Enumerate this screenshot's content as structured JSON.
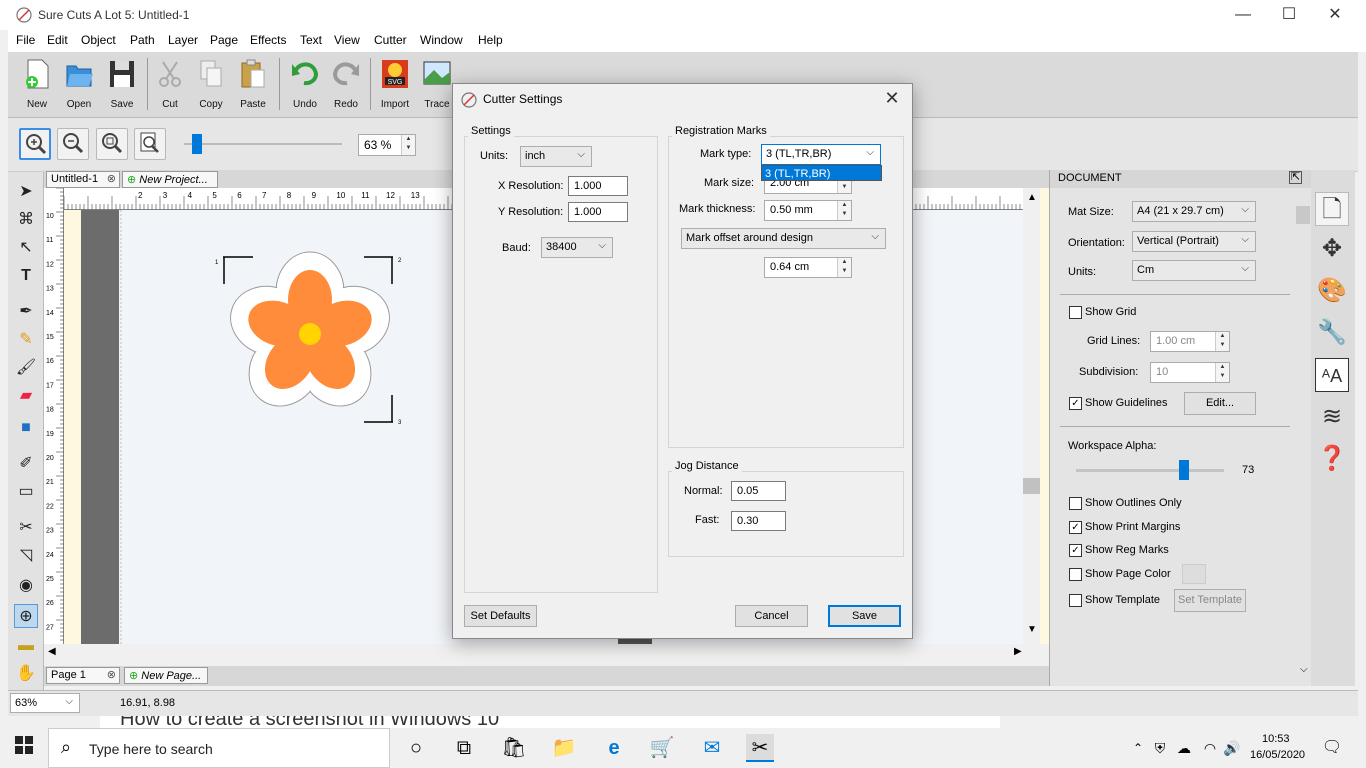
{
  "window": {
    "title": "Sure Cuts A Lot 5: Untitled-1",
    "minimize": "—",
    "maximize": "☐",
    "close": "✕"
  },
  "menu": [
    "File",
    "Edit",
    "Object",
    "Path",
    "Layer",
    "Page",
    "Effects",
    "Text",
    "View",
    "Cutter",
    "Window",
    "Help"
  ],
  "toolbar": {
    "new": "New",
    "open": "Open",
    "save": "Save",
    "cut": "Cut",
    "copy": "Copy",
    "paste": "Paste",
    "undo": "Undo",
    "redo": "Redo",
    "import": "Import",
    "trace": "Trace"
  },
  "zoom": {
    "value": "63 %"
  },
  "tabs": {
    "doc": "Untitled-1",
    "new_project": "New Project...",
    "page": "Page 1",
    "new_page": "New Page..."
  },
  "status": {
    "zoom": "63%",
    "coords": "16.91, 8.98"
  },
  "ruler_left_labels": [
    "10",
    "11",
    "12",
    "13",
    "14",
    "15",
    "16",
    "17",
    "18",
    "19",
    "20",
    "21",
    "22",
    "23",
    "24",
    "25",
    "26",
    "27"
  ],
  "ruler_top_labels": [
    "2",
    "3",
    "4",
    "5",
    "6",
    "7",
    "8",
    "9",
    "10",
    "11",
    "12",
    "13"
  ],
  "reg_mark_labels": [
    "1",
    "2",
    "3"
  ],
  "document_panel": {
    "header": "DOCUMENT",
    "mat_size_label": "Mat Size:",
    "mat_size": "A4 (21 x 29.7 cm)",
    "orientation_label": "Orientation:",
    "orientation": "Vertical (Portrait)",
    "units_label": "Units:",
    "units": "Cm",
    "show_grid": "Show Grid",
    "grid_lines_label": "Grid Lines:",
    "grid_lines": "1.00 cm",
    "subdivision_label": "Subdivision:",
    "subdivision": "10",
    "show_guidelines": "Show Guidelines",
    "edit_button": "Edit...",
    "workspace_alpha_label": "Workspace Alpha:",
    "workspace_alpha": "73",
    "workspace_alpha_level": 0.73,
    "show_outlines_only": "Show Outlines Only",
    "show_print_margins": "Show Print Margins",
    "show_reg_marks": "Show Reg Marks",
    "show_page_color": "Show Page Color",
    "show_template": "Show Template",
    "set_template": "Set Template"
  },
  "dialog": {
    "title": "Cutter Settings",
    "settings_group": "Settings",
    "units_label": "Units:",
    "units": "inch",
    "x_res_label": "X Resolution:",
    "x_res": "1.000",
    "y_res_label": "Y Resolution:",
    "y_res": "1.000",
    "baud_label": "Baud:",
    "baud": "38400",
    "reg_group": "Registration Marks",
    "mark_type_label": "Mark type:",
    "mark_type": "3 (TL,TR,BR)",
    "mark_type_option": "3 (TL,TR,BR)",
    "mark_size_label": "Mark size:",
    "mark_size": "2.00 cm",
    "mark_thickness_label": "Mark thickness:",
    "mark_thickness": "0.50 mm",
    "offset_mode": "Mark offset around design",
    "offset_value": "0.64 cm",
    "jog_group": "Jog Distance",
    "normal_label": "Normal:",
    "normal": "0.05",
    "fast_label": "Fast:",
    "fast": "0.30",
    "set_defaults": "Set Defaults",
    "cancel": "Cancel",
    "save": "Save"
  },
  "behind_text": "How to create a screenshot in Windows 10",
  "taskbar": {
    "search_placeholder": "Type here to search",
    "time": "10:53",
    "date": "16/05/2020"
  },
  "colors": {
    "accent": "#0078d7",
    "flower": "#ff8c3a",
    "flower_center": "#ffd400"
  }
}
